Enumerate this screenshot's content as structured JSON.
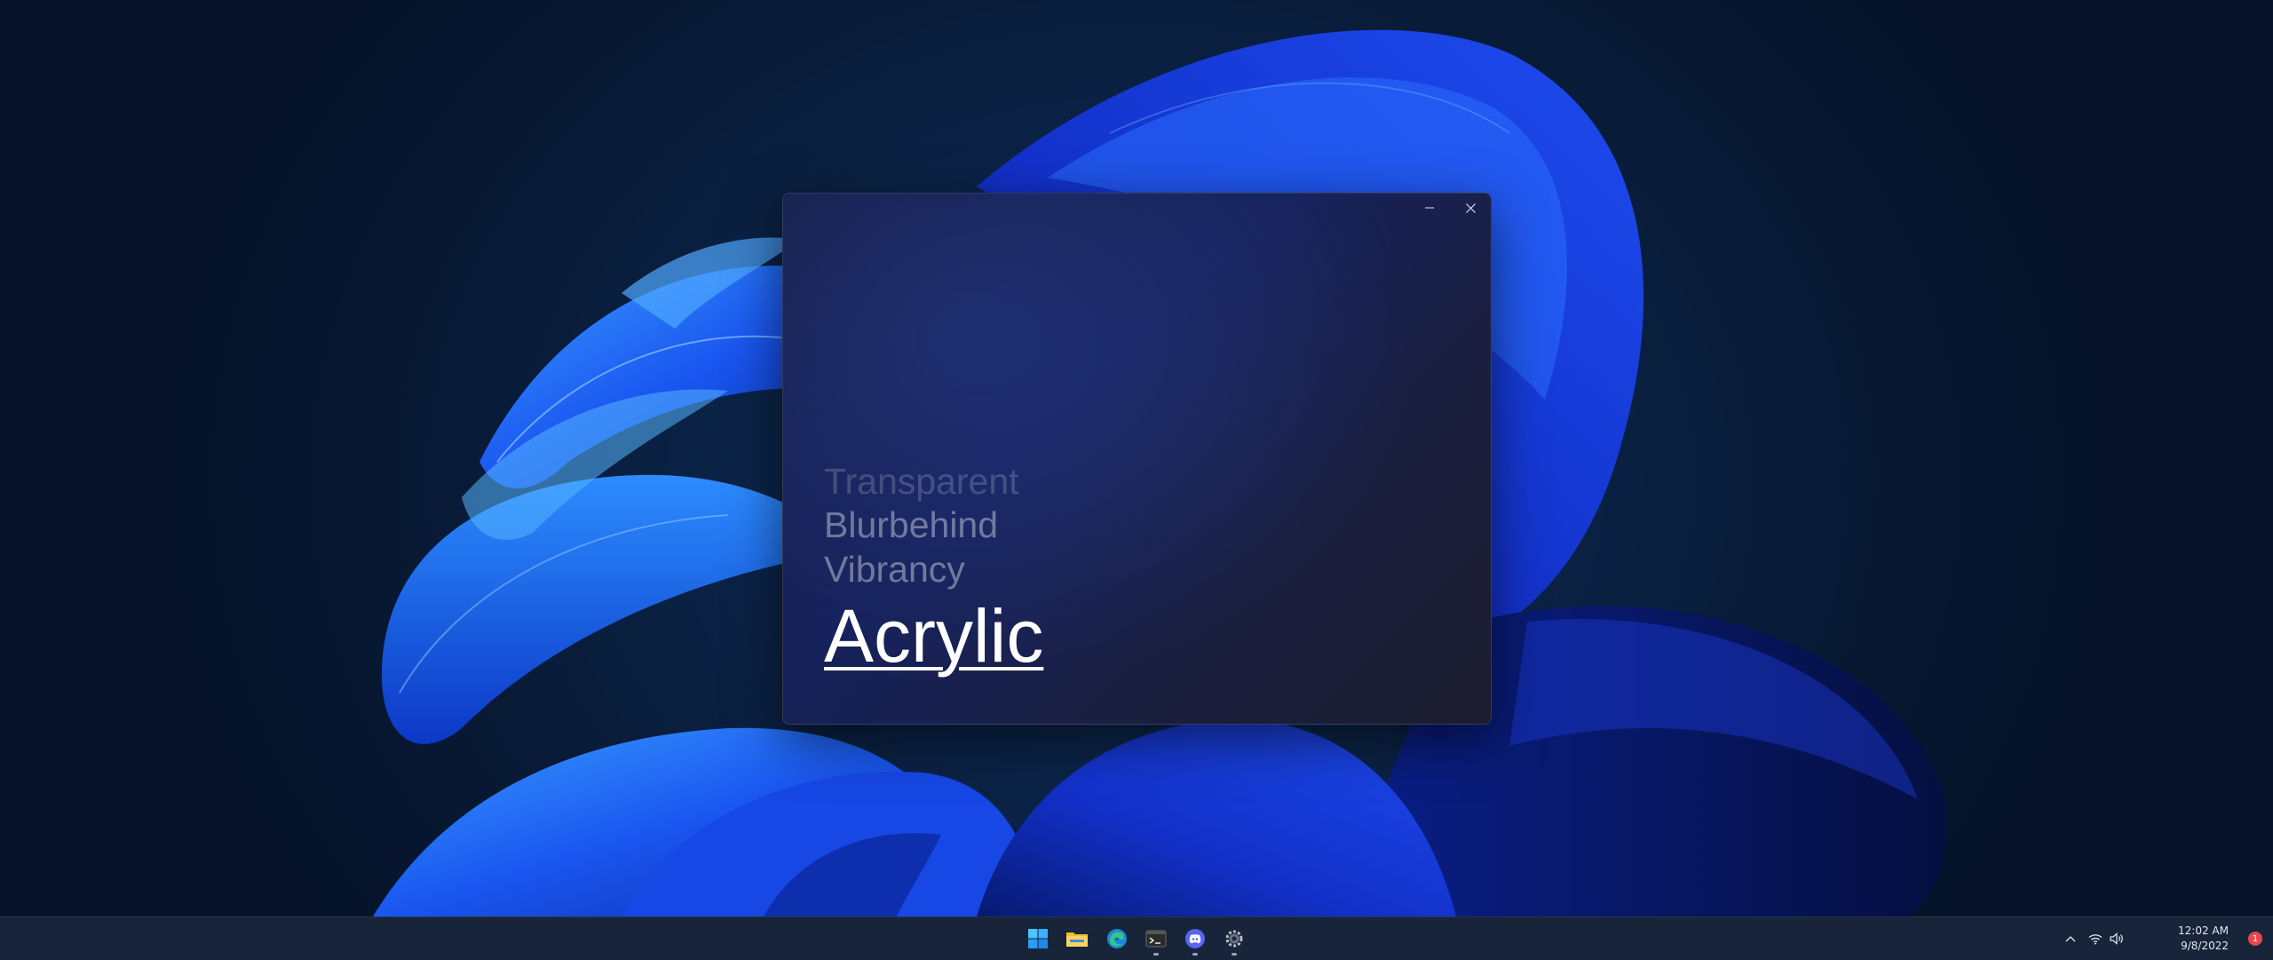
{
  "window": {
    "minimize_label": "Minimize",
    "close_label": "Close",
    "words": [
      "Transparent",
      "Blurbehind",
      "Vibrancy",
      "Acrylic"
    ]
  },
  "taskbar": {
    "apps": [
      "start-icon",
      "file-explorer-icon",
      "edge-icon",
      "terminal-icon",
      "discord-icon",
      "settings-icon"
    ],
    "tray": {
      "time": "12:02 AM",
      "date": "9/8/2022",
      "notification_count": "1"
    }
  },
  "colors": {
    "accent": "#1f6bff",
    "taskbar": "#18243a",
    "notification": "#e8474b"
  }
}
